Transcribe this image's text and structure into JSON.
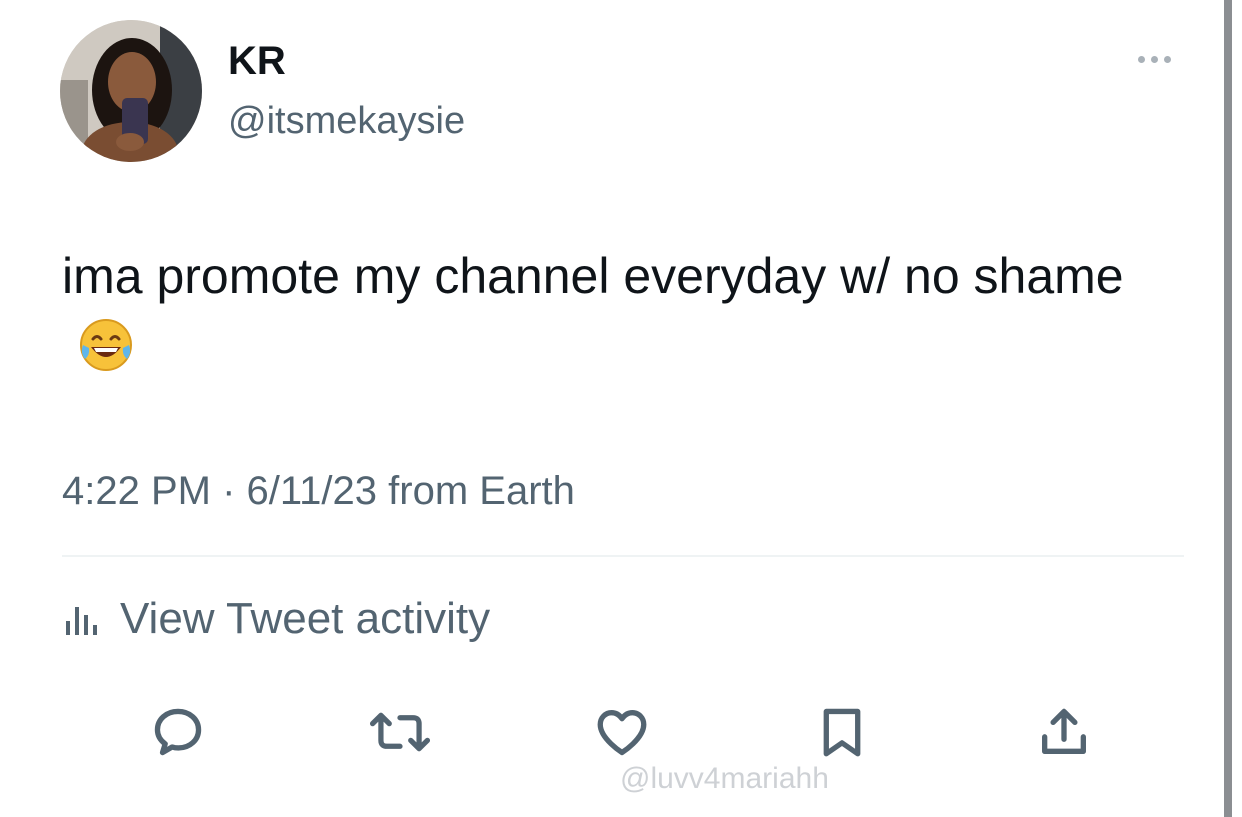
{
  "author": {
    "display_name": "KR",
    "handle": "@itsmekaysie"
  },
  "tweet": {
    "text": "ima promote my channel everyday w/ no shame",
    "emoji": "face-with-tears-of-joy",
    "time": "4:22 PM",
    "separator": "·",
    "date": "6/11/23",
    "source": "from Earth"
  },
  "activity": {
    "label": "View Tweet activity"
  },
  "actions": {
    "icons": [
      "reply-icon",
      "retweet-icon",
      "like-icon",
      "bookmark-icon",
      "share-icon"
    ]
  },
  "watermark": {
    "text": "@luvv4mariahh"
  },
  "colors": {
    "text_primary": "#0f1419",
    "text_secondary": "#536471",
    "icon": "#536471",
    "divider": "#eff3f4"
  }
}
